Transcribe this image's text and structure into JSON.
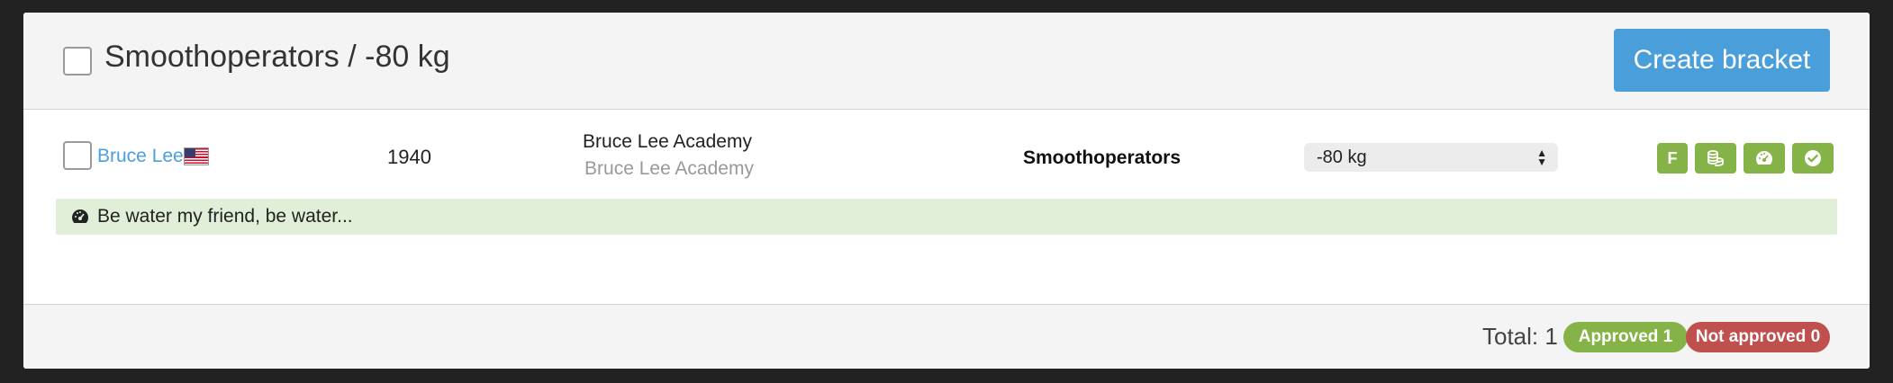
{
  "header": {
    "title": "Smoothoperators / -80 kg",
    "create_bracket_label": "Create bracket"
  },
  "rows": [
    {
      "name": "Bruce Lee",
      "flag_icon": "us-flag-icon",
      "year": "1940",
      "club_primary": "Bruce Lee Academy",
      "club_secondary": "Bruce Lee Academy",
      "team": "Smoothoperators",
      "weight_class": "-80 kg",
      "actions": [
        {
          "label": "F",
          "icon": "f-letter"
        },
        {
          "icon": "coins-icon"
        },
        {
          "icon": "gauge-icon"
        },
        {
          "icon": "check-circle-icon"
        }
      ],
      "note": "Be water my friend, be water...",
      "note_icon": "gauge-icon"
    }
  ],
  "footer": {
    "total_label": "Total: 1",
    "approved_label": "Approved 1",
    "not_approved_label": "Not approved 0"
  },
  "colors": {
    "accent_blue": "#4a9fdb",
    "approved_green": "#86b347",
    "not_approved_red": "#c0504d",
    "note_bg": "#e1efd8"
  }
}
